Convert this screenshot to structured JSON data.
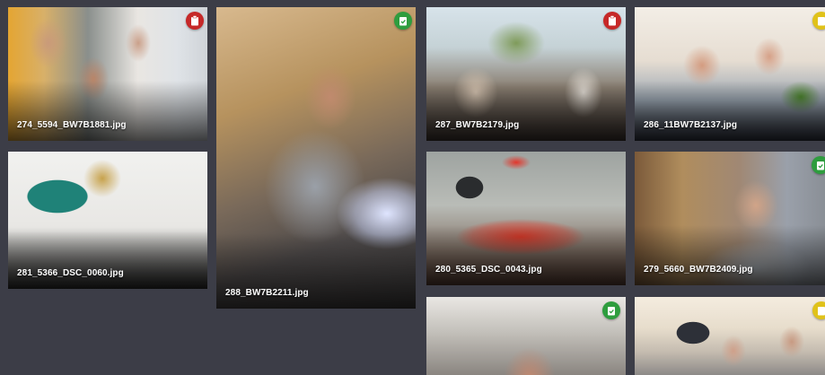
{
  "gallery": {
    "photos": [
      {
        "filename": "274_5594_BW7B1881.jpg",
        "status": "red",
        "status_icon": "clipboard-icon"
      },
      {
        "filename": "288_BW7B2211.jpg",
        "status": "green",
        "status_icon": "check-clipboard-icon"
      },
      {
        "filename": "287_BW7B2179.jpg",
        "status": "red",
        "status_icon": "clipboard-icon"
      },
      {
        "filename": "286_11BW7B2137.jpg",
        "status": "yellow",
        "status_icon": "clipboard-icon"
      },
      {
        "filename": "281_5366_DSC_0060.jpg",
        "status": "",
        "status_icon": ""
      },
      {
        "filename": "280_5365_DSC_0043.jpg",
        "status": "",
        "status_icon": ""
      },
      {
        "filename": "279_5660_BW7B2409.jpg",
        "status": "green",
        "status_icon": "check-clipboard-icon"
      },
      {
        "filename": "",
        "status": "green",
        "status_icon": "check-clipboard-icon"
      },
      {
        "filename": "",
        "status": "yellow",
        "status_icon": "clipboard-icon"
      }
    ]
  },
  "colors": {
    "background": "#3c3d47",
    "status_red": "#c62828",
    "status_green": "#2e9d3e",
    "status_yellow": "#e0c21a"
  }
}
